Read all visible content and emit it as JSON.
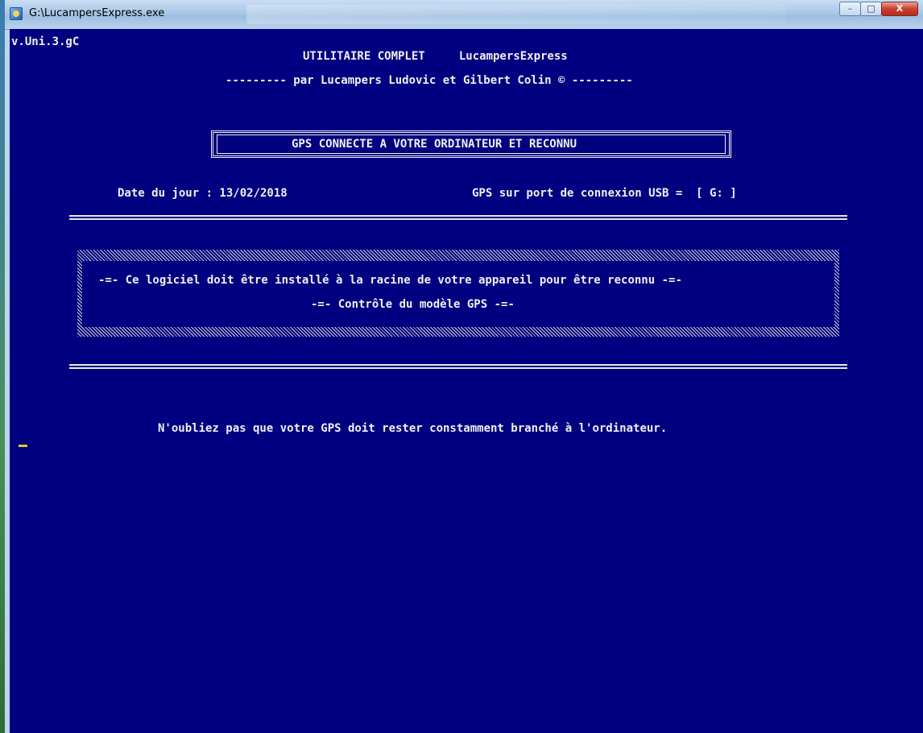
{
  "window": {
    "title": "G:\\LucampersExpress.exe",
    "controls": {
      "minimize": "–",
      "maximize": "□",
      "close": "X"
    }
  },
  "console": {
    "version": "v.Uni.3.gC",
    "header_line1": "UTILITAIRE COMPLET     LucampersExpress",
    "header_line2": "--------- par Lucampers Ludovic et Gilbert Colin © ---------",
    "gps_status": "GPS CONNECTE A VOTRE ORDINATEUR ET RECONNU",
    "date_line": "Date du jour : 13/02/2018",
    "port_line": "GPS sur port de connexion USB =  [ G: ]",
    "notice_line1": "-=- Ce logiciel doit être installé à la racine de votre appareil pour être reconnu -=-",
    "notice_line2": "-=- Contrôle du modèle GPS -=-",
    "reminder": "N'oubliez pas que votre GPS doit rester constamment branché à l'ordinateur."
  },
  "colors": {
    "console_bg": "#000080",
    "console_text": "#f0f0f0",
    "cursor": "#e6c81f"
  }
}
